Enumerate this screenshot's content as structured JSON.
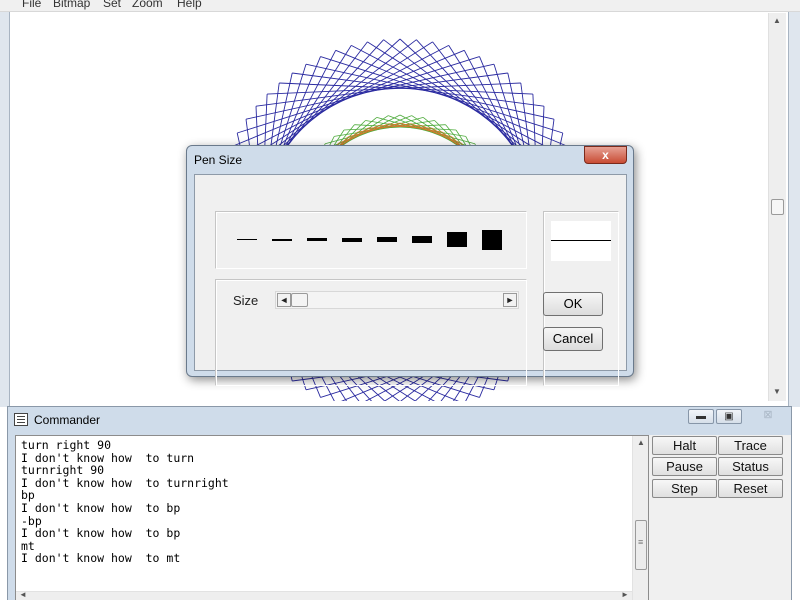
{
  "menu": [
    "File",
    "Bitmap",
    "Set",
    "Zoom",
    "Help"
  ],
  "dialog": {
    "title": "Pen Size",
    "close_glyph": "x",
    "size_label": "Size",
    "ok_label": "OK",
    "cancel_label": "Cancel",
    "scroll_left_glyph": "◄",
    "scroll_right_glyph": "►"
  },
  "commander": {
    "title": "Commander",
    "minimize_glyph": "▬",
    "restore_glyph": "▣",
    "close_glyph": "⊠",
    "output": [
      "turn right 90",
      "I don't know how  to turn",
      "turnright 90",
      "I don't know how  to turnright",
      "bp",
      "I don't know how  to bp",
      "-bp",
      "I don't know how  to bp",
      "mt",
      "I don't know how  to mt"
    ],
    "buttons": {
      "halt": "Halt",
      "trace": "Trace",
      "pause": "Pause",
      "status": "Status",
      "step": "Step",
      "reset": "Reset"
    }
  },
  "colors": {
    "pattern_outer": "#2a2aa0",
    "pattern_inner_green": "#4caa3a",
    "pattern_inner_orange": "#d4782c",
    "title_bar": "#cfdcea",
    "close_red": "#c84c34"
  }
}
